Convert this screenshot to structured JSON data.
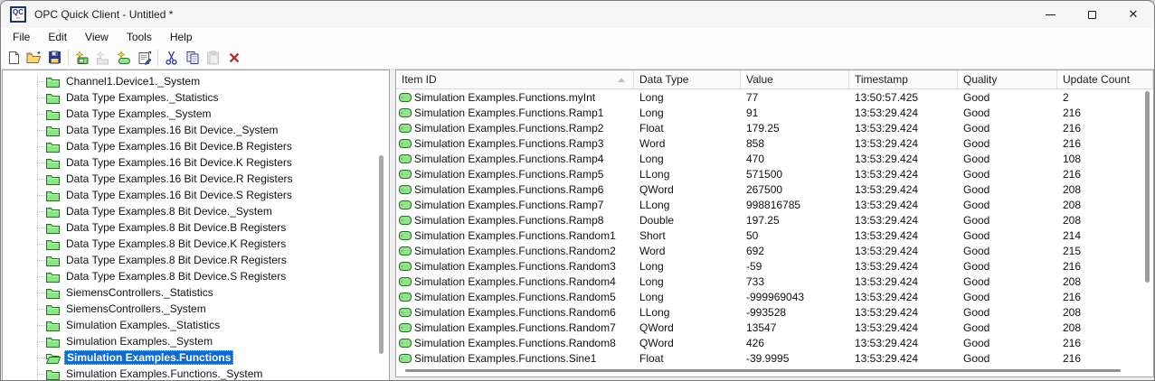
{
  "window": {
    "title": "OPC Quick Client - Untitled *",
    "app_icon_text": "QC",
    "controls": {
      "minimize": "minimize",
      "maximize": "maximize",
      "close": "close"
    }
  },
  "menu": {
    "items": [
      "File",
      "Edit",
      "View",
      "Tools",
      "Help"
    ]
  },
  "toolbar": {
    "groups": [
      [
        {
          "name": "new-file",
          "enabled": true
        },
        {
          "name": "open-file",
          "enabled": true
        },
        {
          "name": "save-file",
          "enabled": true
        }
      ],
      [
        {
          "name": "new-server-connection",
          "enabled": true
        },
        {
          "name": "new-group",
          "enabled": false
        },
        {
          "name": "new-item",
          "enabled": true
        },
        {
          "name": "properties",
          "enabled": true
        }
      ],
      [
        {
          "name": "cut",
          "enabled": true
        },
        {
          "name": "copy",
          "enabled": true
        },
        {
          "name": "paste",
          "enabled": false
        },
        {
          "name": "delete",
          "enabled": true
        }
      ]
    ]
  },
  "tree": {
    "items": [
      {
        "label": "Channel1.Device1._System",
        "selected": false
      },
      {
        "label": "Data Type Examples._Statistics",
        "selected": false
      },
      {
        "label": "Data Type Examples._System",
        "selected": false
      },
      {
        "label": "Data Type Examples.16 Bit Device._System",
        "selected": false
      },
      {
        "label": "Data Type Examples.16 Bit Device.B Registers",
        "selected": false
      },
      {
        "label": "Data Type Examples.16 Bit Device.K Registers",
        "selected": false
      },
      {
        "label": "Data Type Examples.16 Bit Device.R Registers",
        "selected": false
      },
      {
        "label": "Data Type Examples.16 Bit Device.S Registers",
        "selected": false
      },
      {
        "label": "Data Type Examples.8 Bit Device._System",
        "selected": false
      },
      {
        "label": "Data Type Examples.8 Bit Device.B Registers",
        "selected": false
      },
      {
        "label": "Data Type Examples.8 Bit Device.K Registers",
        "selected": false
      },
      {
        "label": "Data Type Examples.8 Bit Device.R Registers",
        "selected": false
      },
      {
        "label": "Data Type Examples.8 Bit Device.S Registers",
        "selected": false
      },
      {
        "label": "SiemensControllers._Statistics",
        "selected": false
      },
      {
        "label": "SiemensControllers._System",
        "selected": false
      },
      {
        "label": "Simulation Examples._Statistics",
        "selected": false
      },
      {
        "label": "Simulation Examples._System",
        "selected": false
      },
      {
        "label": "Simulation Examples.Functions",
        "selected": true
      },
      {
        "label": "Simulation Examples.Functions._System",
        "selected": false
      }
    ]
  },
  "table": {
    "columns": [
      "Item ID",
      "Data Type",
      "Value",
      "Timestamp",
      "Quality",
      "Update Count"
    ],
    "sort_column": "Item ID",
    "sort_direction": "ascending",
    "rows": [
      [
        "Simulation Examples.Functions.myInt",
        "Long",
        "77",
        "13:50:57.425",
        "Good",
        "2"
      ],
      [
        "Simulation Examples.Functions.Ramp1",
        "Long",
        "91",
        "13:53:29.424",
        "Good",
        "216"
      ],
      [
        "Simulation Examples.Functions.Ramp2",
        "Float",
        "179.25",
        "13:53:29.424",
        "Good",
        "216"
      ],
      [
        "Simulation Examples.Functions.Ramp3",
        "Word",
        "858",
        "13:53:29.424",
        "Good",
        "216"
      ],
      [
        "Simulation Examples.Functions.Ramp4",
        "Long",
        "470",
        "13:53:29.424",
        "Good",
        "108"
      ],
      [
        "Simulation Examples.Functions.Ramp5",
        "LLong",
        "571500",
        "13:53:29.424",
        "Good",
        "216"
      ],
      [
        "Simulation Examples.Functions.Ramp6",
        "QWord",
        "267500",
        "13:53:29.424",
        "Good",
        "208"
      ],
      [
        "Simulation Examples.Functions.Ramp7",
        "LLong",
        "998816785",
        "13:53:29.424",
        "Good",
        "208"
      ],
      [
        "Simulation Examples.Functions.Ramp8",
        "Double",
        "197.25",
        "13:53:29.424",
        "Good",
        "208"
      ],
      [
        "Simulation Examples.Functions.Random1",
        "Short",
        "50",
        "13:53:29.424",
        "Good",
        "214"
      ],
      [
        "Simulation Examples.Functions.Random2",
        "Word",
        "692",
        "13:53:29.424",
        "Good",
        "215"
      ],
      [
        "Simulation Examples.Functions.Random3",
        "Long",
        "-59",
        "13:53:29.424",
        "Good",
        "216"
      ],
      [
        "Simulation Examples.Functions.Random4",
        "Long",
        "733",
        "13:53:29.424",
        "Good",
        "208"
      ],
      [
        "Simulation Examples.Functions.Random5",
        "Long",
        "-999969043",
        "13:53:29.424",
        "Good",
        "216"
      ],
      [
        "Simulation Examples.Functions.Random6",
        "LLong",
        "-993528",
        "13:53:29.424",
        "Good",
        "208"
      ],
      [
        "Simulation Examples.Functions.Random7",
        "QWord",
        "13547",
        "13:53:29.424",
        "Good",
        "208"
      ],
      [
        "Simulation Examples.Functions.Random8",
        "QWord",
        "426",
        "13:53:29.424",
        "Good",
        "216"
      ],
      [
        "Simulation Examples.Functions.Sine1",
        "Float",
        "-39.9995",
        "13:53:29.424",
        "Good",
        "216"
      ]
    ]
  },
  "colors": {
    "selection_blue": "#0d6bd1",
    "folder_green": "#8ae584",
    "tag_green": "#8fe588",
    "delete_red": "#b52525",
    "quality_good": "Good"
  }
}
